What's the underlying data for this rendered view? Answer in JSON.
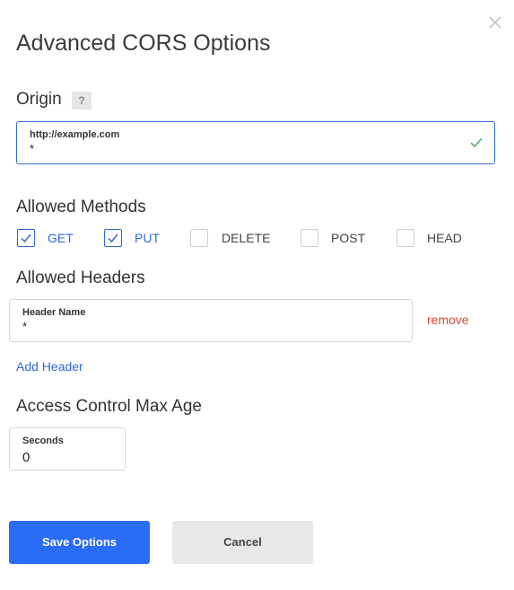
{
  "dialog": {
    "title": "Advanced CORS Options"
  },
  "origin": {
    "label": "Origin",
    "help": "?",
    "field_label": "http://example.com",
    "value": "*"
  },
  "methods": {
    "label": "Allowed Methods",
    "items": [
      {
        "label": "GET",
        "checked": true
      },
      {
        "label": "PUT",
        "checked": true
      },
      {
        "label": "DELETE",
        "checked": false
      },
      {
        "label": "POST",
        "checked": false
      },
      {
        "label": "HEAD",
        "checked": false
      }
    ]
  },
  "headers": {
    "label": "Allowed Headers",
    "field_label": "Header Name",
    "value": "*",
    "remove_label": "remove",
    "add_label": "Add Header"
  },
  "max_age": {
    "label": "Access Control Max Age",
    "field_label": "Seconds",
    "value": "0"
  },
  "actions": {
    "save_label": "Save Options",
    "cancel_label": "Cancel"
  },
  "colors": {
    "accent": "#2a6df4",
    "link": "#2e6bd9",
    "danger": "#d9493b",
    "success": "#4cae6a"
  }
}
